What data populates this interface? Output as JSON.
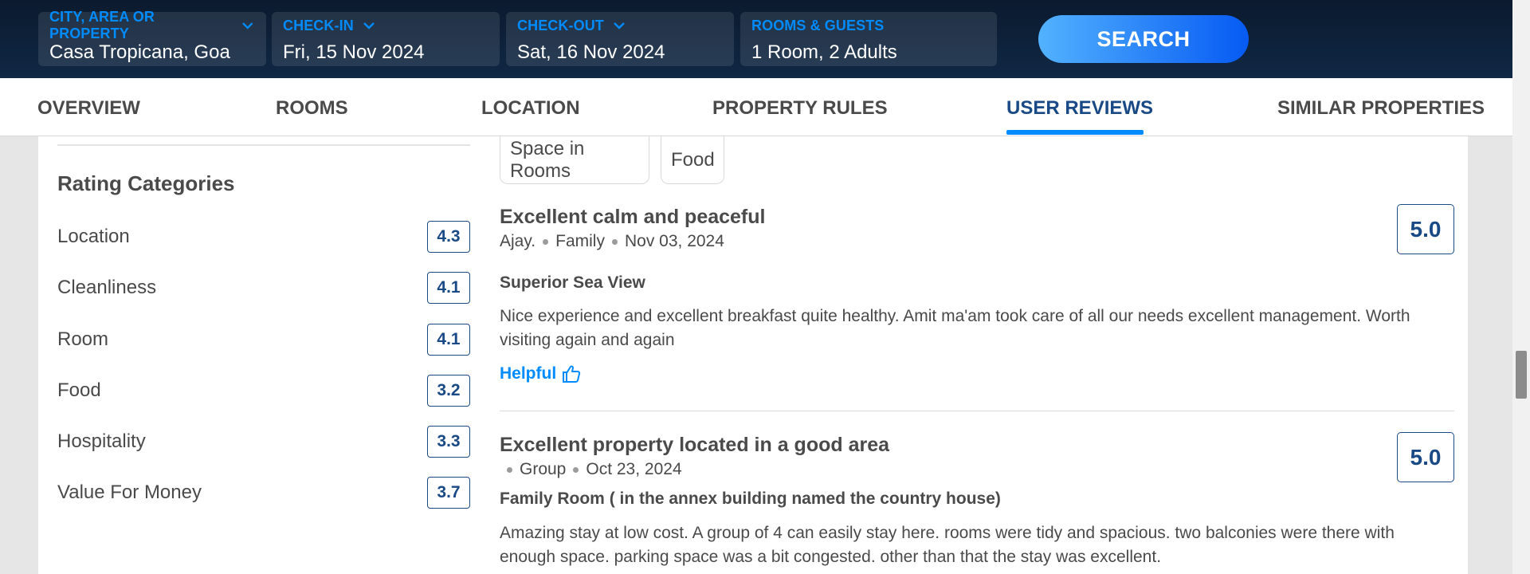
{
  "search": {
    "city": {
      "label": "CITY, AREA OR PROPERTY",
      "value": "Casa Tropicana, Goa"
    },
    "checkin": {
      "label": "CHECK-IN",
      "value": "Fri, 15 Nov 2024"
    },
    "checkout": {
      "label": "CHECK-OUT",
      "value": "Sat, 16 Nov 2024"
    },
    "guests": {
      "label": "ROOMS & GUESTS",
      "value": "1 Room, 2 Adults"
    },
    "button": "SEARCH"
  },
  "tabs": [
    "OVERVIEW",
    "ROOMS",
    "LOCATION",
    "PROPERTY RULES",
    "USER REVIEWS",
    "SIMILAR PROPERTIES"
  ],
  "active_tab": "USER REVIEWS",
  "rating_categories": {
    "title": "Rating Categories",
    "items": [
      {
        "name": "Location",
        "score": "4.3"
      },
      {
        "name": "Cleanliness",
        "score": "4.1"
      },
      {
        "name": "Room",
        "score": "4.1"
      },
      {
        "name": "Food",
        "score": "3.2"
      },
      {
        "name": "Hospitality",
        "score": "3.3"
      },
      {
        "name": "Value For Money",
        "score": "3.7"
      }
    ]
  },
  "filter_chips": [
    "Space in Rooms",
    "Food"
  ],
  "reviews": [
    {
      "title": "Excellent calm and peaceful",
      "author": "Ajay.",
      "traveller_type": "Family",
      "date": "Nov 03, 2024",
      "score": "5.0",
      "room": "Superior Sea View",
      "text": "Nice experience and excellent breakfast quite healthy. Amit ma'am took care of all our needs excellent management. Worth visiting again and again",
      "helpful": "Helpful"
    },
    {
      "title": "Excellent property located in a good area",
      "author": "",
      "traveller_type": "Group",
      "date": "Oct 23, 2024",
      "score": "5.0",
      "room": "Family Room ( in the annex building named the country house)",
      "text": "Amazing stay at low cost. A group of 4 can easily stay here. rooms were tidy and spacious. two balconies were there with enough space. parking space was a bit congested. other than that the stay was excellent."
    }
  ],
  "colors": {
    "accent": "#008cff",
    "score_blue": "#1a4a86",
    "header_bg": "#0b1a2e"
  }
}
